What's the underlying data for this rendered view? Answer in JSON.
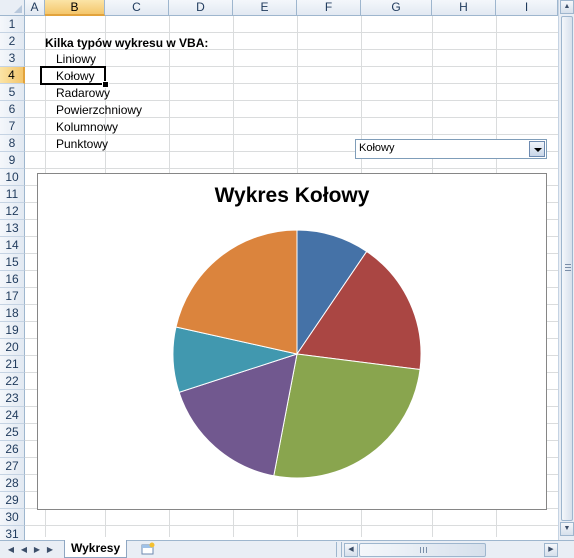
{
  "columns": [
    "A",
    "B",
    "C",
    "D",
    "E",
    "F",
    "G",
    "H",
    "I"
  ],
  "selected_column": "B",
  "rows": [
    "1",
    "2",
    "3",
    "4",
    "5",
    "6",
    "7",
    "8",
    "9",
    "10",
    "11",
    "12",
    "13",
    "14",
    "15",
    "16",
    "17",
    "18",
    "19",
    "20",
    "21",
    "22",
    "23",
    "24",
    "25",
    "26",
    "27",
    "28",
    "29",
    "30",
    "31"
  ],
  "selected_row": "4",
  "sheet": {
    "title": "Kilka typów wykresu w VBA:",
    "types": [
      "Liniowy",
      "Kołowy",
      "Radarowy",
      "Powierzchniowy",
      "Kolumnowy",
      "Punktowy"
    ],
    "active_item": "Kołowy"
  },
  "combo": {
    "value": "Kołowy"
  },
  "chart_data": {
    "type": "pie",
    "title": "Wykres Kołowy",
    "values": [
      9.5,
      17.5,
      26,
      17,
      8.5,
      21.5
    ],
    "colors": [
      "#4572a7",
      "#aa4643",
      "#89a54e",
      "#71588f",
      "#4198af",
      "#db843d"
    ],
    "start_angle_deg": 0
  },
  "tabs": {
    "active": "Wykresy"
  },
  "icons": [
    "first-sheet-icon",
    "prev-sheet-icon",
    "next-sheet-icon",
    "last-sheet-icon",
    "new-sheet-icon",
    "scroll-up-icon",
    "scroll-down-icon",
    "scroll-left-icon",
    "scroll-right-icon"
  ]
}
